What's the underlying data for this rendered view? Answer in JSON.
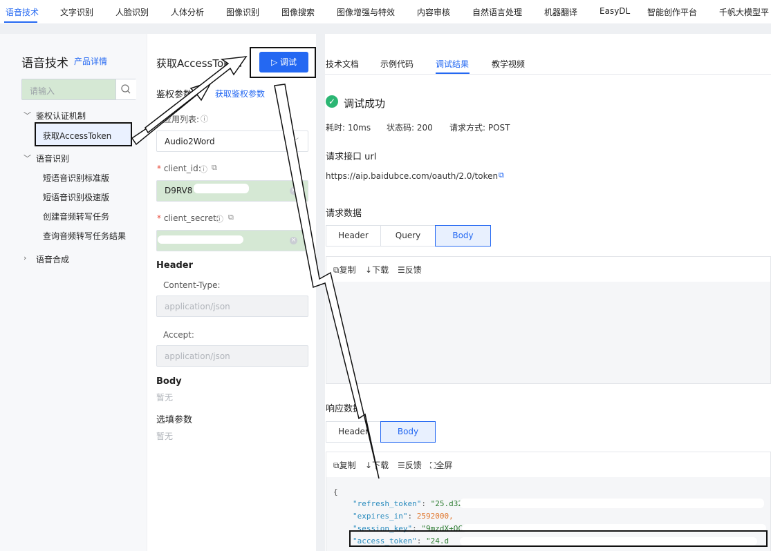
{
  "topnav": {
    "items": [
      "语音技术",
      "文字识别",
      "人脸识别",
      "人体分析",
      "图像识别",
      "图像搜索",
      "图像增强与特效",
      "内容审核",
      "自然语言处理",
      "机器翻译",
      "EasyDL",
      "智能创作平台",
      "千帆大模型平"
    ],
    "active_index": 0
  },
  "sidebar": {
    "title": "语音技术",
    "detail_link": "产品详情",
    "search_placeholder": "请输入",
    "groups": [
      {
        "label": "鉴权认证机制",
        "expanded": true,
        "items": [
          "获取AccessToken"
        ]
      },
      {
        "label": "语音识别",
        "expanded": true,
        "items": [
          "短语音识别标准版",
          "短语音识别极速版",
          "创建音频转写任务",
          "查询音频转写任务结果"
        ]
      },
      {
        "label": "语音合成",
        "expanded": false,
        "items": []
      }
    ],
    "selected_item": "获取AccessToken"
  },
  "middle": {
    "title": "获取AccessToken",
    "debug_button": "调试",
    "auth_params_label": "鉴权参数",
    "get_auth_link": "获取鉴权参数",
    "app_list_label": "应用列表:",
    "app_list_value": "Audio2Word",
    "client_id_label": "client_id:",
    "client_id_value": "D9RV8",
    "client_secret_label": "client_secret:",
    "header_section": "Header",
    "content_type_label": "Content-Type:",
    "content_type_value": "application/json",
    "accept_label": "Accept:",
    "accept_value": "application/json",
    "body_section": "Body",
    "body_empty": "暂无",
    "optional_section": "选填参数",
    "optional_empty": "暂无"
  },
  "right": {
    "tabs": [
      "技术文档",
      "示例代码",
      "调试结果",
      "教学视频"
    ],
    "active_tab": "调试结果",
    "status": "调试成功",
    "elapsed": "耗时: 10ms",
    "status_code": "状态码: 200",
    "method": "请求方式: POST",
    "endpoint_heading": "请求接口 url",
    "endpoint_url": "https://aip.baidubce.com/oauth/2.0/token",
    "request_heading": "请求数据",
    "request_tabs": [
      "Header",
      "Query",
      "Body"
    ],
    "request_active": "Body",
    "toolbar_copy": "复制",
    "toolbar_download": "下载",
    "toolbar_feedback": "反馈",
    "toolbar_fullscreen": "全屏",
    "response_heading": "响应数据",
    "response_tabs": [
      "Header",
      "Body"
    ],
    "response_active": "Body",
    "json_lines": {
      "open": "{",
      "refresh_token_key": "\"refresh_token\"",
      "refresh_token_val": "\"25.d32C",
      "expires_in_key": "\"expires_in\"",
      "expires_in_val": "2592000,",
      "session_key_key": "\"session_key\"",
      "session_key_val": "\"9mzdX+QCa0vWWm/+6I",
      "access_token_key": "\"access_token\"",
      "access_token_val": "\"24.d"
    }
  },
  "colors": {
    "accent": "#2468f2",
    "success": "#2bb673",
    "highlight_green": "#d5e8d4"
  }
}
